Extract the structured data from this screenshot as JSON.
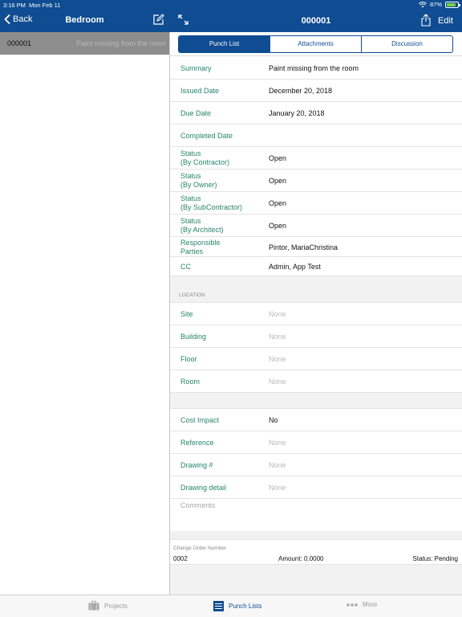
{
  "status_bar": {
    "time": "3:16 PM",
    "date": "Mon Feb 11",
    "battery": "87%",
    "battery_level": 0.87
  },
  "left_nav": {
    "back_label": "Back",
    "title": "Bedroom"
  },
  "left_list": [
    {
      "number": "000001",
      "summary": "Paint missing from the room"
    }
  ],
  "right_nav": {
    "title": "000001",
    "edit_label": "Edit"
  },
  "tabs": [
    {
      "label": "Punch List",
      "active": true
    },
    {
      "label": "Attachments",
      "active": false
    },
    {
      "label": "Discussion",
      "active": false
    }
  ],
  "details": {
    "summary": {
      "label": "Summary",
      "value": "Paint missing from the room"
    },
    "issued_date": {
      "label": "Issued Date",
      "value": "December 20, 2018"
    },
    "due_date": {
      "label": "Due Date",
      "value": "January 20, 2018"
    },
    "completed_date": {
      "label": "Completed Date",
      "value": ""
    },
    "status_contractor": {
      "label1": "Status",
      "label2": "(By Contractor)",
      "value": "Open"
    },
    "status_owner": {
      "label1": "Status",
      "label2": "(By Owner)",
      "value": "Open"
    },
    "status_subcontractor": {
      "label1": "Status",
      "label2": "(By SubContractor)",
      "value": "Open"
    },
    "status_architect": {
      "label1": "Status",
      "label2": "(By Architect)",
      "value": "Open"
    },
    "responsible": {
      "label1": "Responsible",
      "label2": "Parties",
      "value": "Pintor, MariaChristina"
    },
    "cc": {
      "label": "CC",
      "value": "Admin, App Test"
    }
  },
  "location": {
    "header": "LOCATION",
    "site": {
      "label": "Site",
      "value": "None"
    },
    "building": {
      "label": "Building",
      "value": "None"
    },
    "floor": {
      "label": "Floor",
      "value": "None"
    },
    "room": {
      "label": "Room",
      "value": "None"
    }
  },
  "extra": {
    "cost_impact": {
      "label": "Cost Impact",
      "value": "No"
    },
    "reference": {
      "label": "Reference",
      "value": "None"
    },
    "drawing_num": {
      "label": "Drawing #",
      "value": "None"
    },
    "drawing_detail": {
      "label": "Drawing detail",
      "value": "None"
    },
    "comments": {
      "label": "Comments"
    }
  },
  "change_order": {
    "label": "Change Order Number",
    "number": "0002",
    "amount": "Amount: 0.0000",
    "status": "Status: Pending"
  },
  "tabbar": {
    "projects": "Projects",
    "punch_lists": "Punch Lists",
    "more": "More"
  },
  "colors": {
    "brand": "#0f4c91",
    "label_green": "#27866a",
    "placeholder": "#b9b9b9"
  }
}
